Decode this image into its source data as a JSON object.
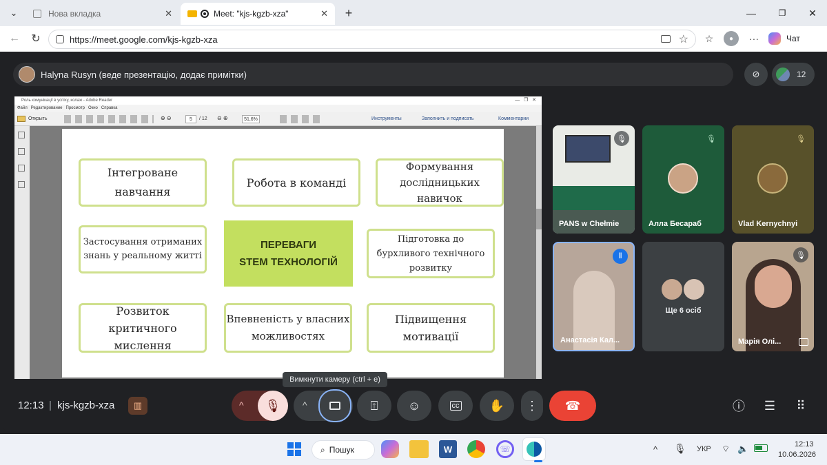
{
  "browser": {
    "tabs": [
      {
        "label": "Нова вкладка"
      },
      {
        "label": "Meet: \"kjs-kgzb-xza\""
      }
    ],
    "url": "https://meet.google.com/kjs-kgzb-xza",
    "chat_label": "Чат"
  },
  "meet": {
    "presenter_banner": "Halyna Rusyn (веде презентацію, додає примітки)",
    "participant_count": "12",
    "tooltip": "Вимкнути камеру (ctrl + e)",
    "time": "12:13",
    "meeting_code": "kjs-kgzb-xza",
    "others_label": "Ще 6 осіб",
    "tiles": [
      {
        "name": "PANS w Chełmie"
      },
      {
        "name": "Алла Бесараб"
      },
      {
        "name": "Vlad Kernychnyi"
      },
      {
        "name": "Анастасія Кал..."
      },
      {
        "name": "Марія Олі..."
      }
    ]
  },
  "pdf": {
    "title": "Роль комунікації в успіху, колаж - Adobe Reader",
    "menu": [
      "Файл",
      "Редактирование",
      "Просмотр",
      "Окно",
      "Справка"
    ],
    "open_label": "Открыть",
    "page_current": "5",
    "page_total": "/ 12",
    "zoom": "51,6%",
    "tools_label": "Инструменты",
    "fill_sign_label": "Заполнить и подписать",
    "comments_label": "Комментарии"
  },
  "slide": {
    "center_line1": "ПЕРЕВАГИ",
    "center_line2": "STEM ТЕХНОЛОГІЙ",
    "boxes": [
      "Інтегроване навчання",
      "Робота в команді",
      "Формування дослідницьких навичок",
      "Застосування отриманих знань у реальному житті",
      "Підготовка до бурхливого технічного розвитку",
      "Розвиток критичного мислення",
      "Впевненість у власних можливостях",
      "Підвищення мотивації"
    ]
  },
  "taskbar": {
    "search_label": "Пошук",
    "lang": "УКР",
    "time": "12:13",
    "date": "10.06.2026"
  },
  "colors": {
    "meet_bg": "#202124",
    "slide_box_border": "#cfe08d",
    "slide_center": "#c3df5f",
    "end_call": "#ea4335",
    "mic_off": "#f9dedc"
  }
}
